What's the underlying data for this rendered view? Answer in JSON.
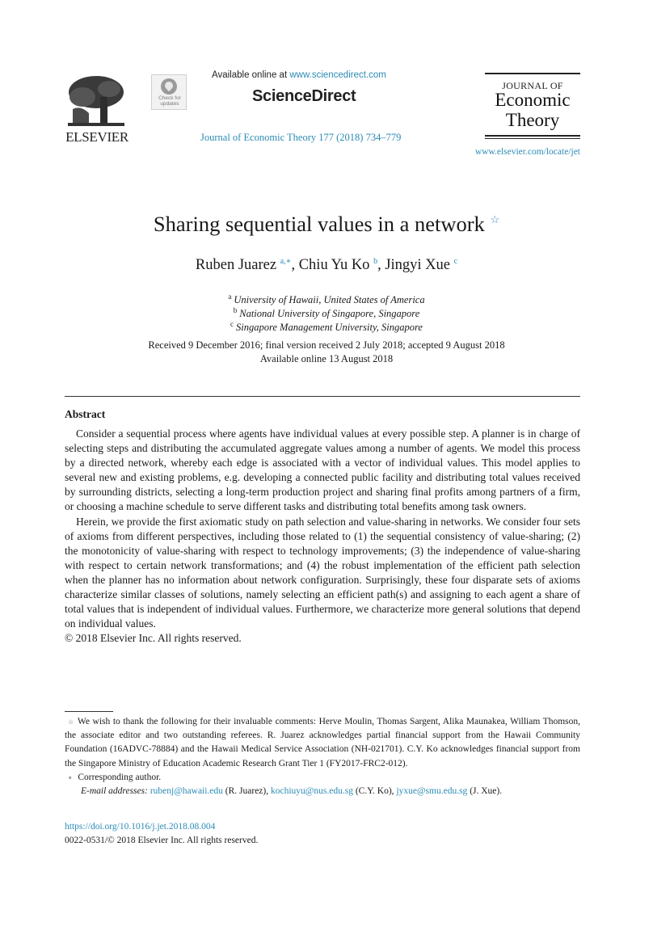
{
  "header": {
    "publisher_logo_icon": "elsevier-tree-icon",
    "publisher_name": "ELSEVIER",
    "check_updates_icon": "crossmark-icon",
    "check_updates_label_line1": "Check for",
    "check_updates_label_line2": "updates",
    "available_online_prefix": "Available online at ",
    "available_online_link": "www.sciencedirect.com",
    "platform_name": "ScienceDirect",
    "journal_reference": "Journal of Economic Theory 177 (2018) 734–779",
    "journal_logo_line1": "JOURNAL OF",
    "journal_logo_line2": "Economic",
    "journal_logo_line3": "Theory",
    "journal_url": "www.elsevier.com/locate/jet"
  },
  "article": {
    "title": "Sharing sequential values in a network",
    "title_note_mark": "☆",
    "authors": [
      {
        "name": "Ruben Juarez",
        "marks": "a,∗"
      },
      {
        "name": "Chiu Yu Ko",
        "marks": "b"
      },
      {
        "name": "Jingyi Xue",
        "marks": "c"
      }
    ],
    "affiliations": [
      {
        "mark": "a",
        "text": "University of Hawaii, United States of America"
      },
      {
        "mark": "b",
        "text": "National University of Singapore, Singapore"
      },
      {
        "mark": "c",
        "text": "Singapore Management University, Singapore"
      }
    ],
    "dates_line1": "Received 9 December 2016; final version received 2 July 2018; accepted 9 August 2018",
    "dates_line2": "Available online 13 August 2018"
  },
  "abstract": {
    "heading": "Abstract",
    "paragraphs": [
      "Consider a sequential process where agents have individual values at every possible step. A planner is in charge of selecting steps and distributing the accumulated aggregate values among a number of agents. We model this process by a directed network, whereby each edge is associated with a vector of individual values. This model applies to several new and existing problems, e.g. developing a connected public facility and distributing total values received by surrounding districts, selecting a long-term production project and sharing final profits among partners of a firm, or choosing a machine schedule to serve different tasks and distributing total benefits among task owners.",
      "Herein, we provide the first axiomatic study on path selection and value-sharing in networks. We consider four sets of axioms from different perspectives, including those related to (1) the sequential consistency of value-sharing; (2) the monotonicity of value-sharing with respect to technology improvements; (3) the independence of value-sharing with respect to certain network transformations; and (4) the robust implementation of the efficient path selection when the planner has no information about network configuration. Surprisingly, these four disparate sets of axioms characterize similar classes of solutions, namely selecting an efficient path(s) and assigning to each agent a share of total values that is independent of individual values. Furthermore, we characterize more general solutions that depend on individual values."
    ],
    "copyright": "© 2018 Elsevier Inc. All rights reserved."
  },
  "footnotes": {
    "acknowledgement_mark": "☆",
    "acknowledgement": "We wish to thank the following for their invaluable comments: Herve Moulin, Thomas Sargent, Alika Maunakea, William Thomson, the associate editor and two outstanding referees. R. Juarez acknowledges partial financial support from the Hawaii Community Foundation (16ADVC-78884) and the Hawaii Medical Service Association (NH-021701). C.Y. Ko acknowledges financial support from the Singapore Ministry of Education Academic Research Grant Tier 1 (FY2017-FRC2-012).",
    "corresponding_mark": "∗",
    "corresponding": "Corresponding author.",
    "email_label": "E-mail addresses:",
    "emails": [
      {
        "address": "rubenj@hawaii.edu",
        "owner": " (R. Juarez), "
      },
      {
        "address": "kochiuyu@nus.edu.sg",
        "owner": " (C.Y. Ko), "
      },
      {
        "address": "jyxue@smu.edu.sg",
        "owner": " (J. Xue)."
      }
    ],
    "doi": "https://doi.org/10.1016/j.jet.2018.08.004",
    "issn_copyright": "0022-0531/© 2018 Elsevier Inc. All rights reserved."
  },
  "colors": {
    "link": "#2b8bb5",
    "text": "#1a1a1a"
  }
}
